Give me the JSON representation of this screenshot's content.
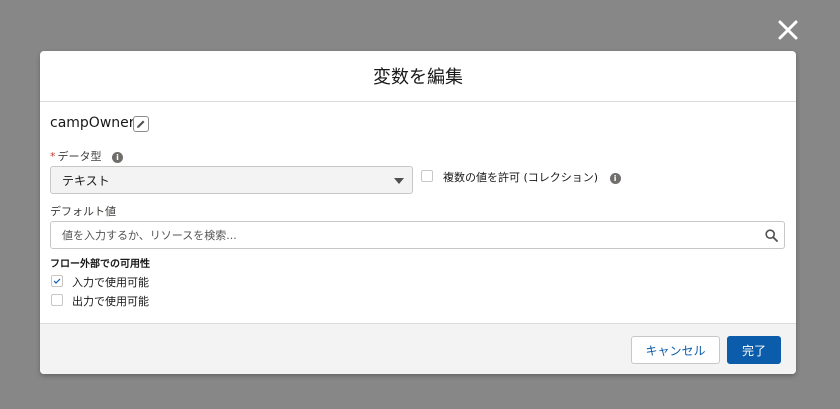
{
  "modal": {
    "title": "変数を編集",
    "variable_name": "campOwner"
  },
  "data_type": {
    "required_marker": "*",
    "label": "データ型",
    "selected": "テキスト"
  },
  "allow_multiple": {
    "label": "複数の値を許可 (コレクション)",
    "checked": false
  },
  "default_value": {
    "label": "デフォルト値",
    "placeholder": "値を入力するか、リソースを検索..."
  },
  "availability": {
    "title": "フロー外部での可用性",
    "input": {
      "label": "入力で使用可能",
      "checked": true
    },
    "output": {
      "label": "出力で使用可能",
      "checked": false
    }
  },
  "footer": {
    "cancel_label": "キャンセル",
    "done_label": "完了"
  },
  "colors": {
    "overlay": "#878787",
    "brand": "#0b5cab",
    "required": "#c23934"
  },
  "icons": [
    "close-icon",
    "pencil-icon",
    "info-icon",
    "chevron-down-icon",
    "search-icon",
    "checkmark-icon"
  ]
}
